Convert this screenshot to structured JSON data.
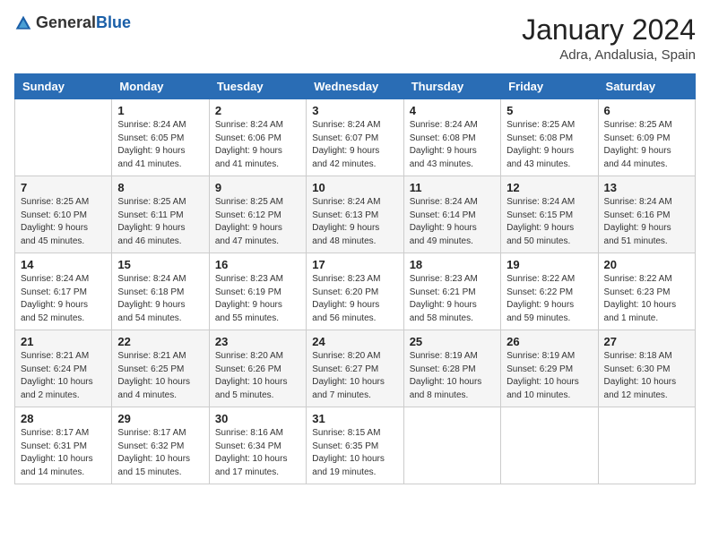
{
  "logo": {
    "text_general": "General",
    "text_blue": "Blue"
  },
  "header": {
    "month": "January 2024",
    "location": "Adra, Andalusia, Spain"
  },
  "weekdays": [
    "Sunday",
    "Monday",
    "Tuesday",
    "Wednesday",
    "Thursday",
    "Friday",
    "Saturday"
  ],
  "weeks": [
    {
      "bg": "white",
      "days": [
        {
          "num": "",
          "info": ""
        },
        {
          "num": "1",
          "info": "Sunrise: 8:24 AM\nSunset: 6:05 PM\nDaylight: 9 hours\nand 41 minutes."
        },
        {
          "num": "2",
          "info": "Sunrise: 8:24 AM\nSunset: 6:06 PM\nDaylight: 9 hours\nand 41 minutes."
        },
        {
          "num": "3",
          "info": "Sunrise: 8:24 AM\nSunset: 6:07 PM\nDaylight: 9 hours\nand 42 minutes."
        },
        {
          "num": "4",
          "info": "Sunrise: 8:24 AM\nSunset: 6:08 PM\nDaylight: 9 hours\nand 43 minutes."
        },
        {
          "num": "5",
          "info": "Sunrise: 8:25 AM\nSunset: 6:08 PM\nDaylight: 9 hours\nand 43 minutes."
        },
        {
          "num": "6",
          "info": "Sunrise: 8:25 AM\nSunset: 6:09 PM\nDaylight: 9 hours\nand 44 minutes."
        }
      ]
    },
    {
      "bg": "gray",
      "days": [
        {
          "num": "7",
          "info": "Sunrise: 8:25 AM\nSunset: 6:10 PM\nDaylight: 9 hours\nand 45 minutes."
        },
        {
          "num": "8",
          "info": "Sunrise: 8:25 AM\nSunset: 6:11 PM\nDaylight: 9 hours\nand 46 minutes."
        },
        {
          "num": "9",
          "info": "Sunrise: 8:25 AM\nSunset: 6:12 PM\nDaylight: 9 hours\nand 47 minutes."
        },
        {
          "num": "10",
          "info": "Sunrise: 8:24 AM\nSunset: 6:13 PM\nDaylight: 9 hours\nand 48 minutes."
        },
        {
          "num": "11",
          "info": "Sunrise: 8:24 AM\nSunset: 6:14 PM\nDaylight: 9 hours\nand 49 minutes."
        },
        {
          "num": "12",
          "info": "Sunrise: 8:24 AM\nSunset: 6:15 PM\nDaylight: 9 hours\nand 50 minutes."
        },
        {
          "num": "13",
          "info": "Sunrise: 8:24 AM\nSunset: 6:16 PM\nDaylight: 9 hours\nand 51 minutes."
        }
      ]
    },
    {
      "bg": "white",
      "days": [
        {
          "num": "14",
          "info": "Sunrise: 8:24 AM\nSunset: 6:17 PM\nDaylight: 9 hours\nand 52 minutes."
        },
        {
          "num": "15",
          "info": "Sunrise: 8:24 AM\nSunset: 6:18 PM\nDaylight: 9 hours\nand 54 minutes."
        },
        {
          "num": "16",
          "info": "Sunrise: 8:23 AM\nSunset: 6:19 PM\nDaylight: 9 hours\nand 55 minutes."
        },
        {
          "num": "17",
          "info": "Sunrise: 8:23 AM\nSunset: 6:20 PM\nDaylight: 9 hours\nand 56 minutes."
        },
        {
          "num": "18",
          "info": "Sunrise: 8:23 AM\nSunset: 6:21 PM\nDaylight: 9 hours\nand 58 minutes."
        },
        {
          "num": "19",
          "info": "Sunrise: 8:22 AM\nSunset: 6:22 PM\nDaylight: 9 hours\nand 59 minutes."
        },
        {
          "num": "20",
          "info": "Sunrise: 8:22 AM\nSunset: 6:23 PM\nDaylight: 10 hours\nand 1 minute."
        }
      ]
    },
    {
      "bg": "gray",
      "days": [
        {
          "num": "21",
          "info": "Sunrise: 8:21 AM\nSunset: 6:24 PM\nDaylight: 10 hours\nand 2 minutes."
        },
        {
          "num": "22",
          "info": "Sunrise: 8:21 AM\nSunset: 6:25 PM\nDaylight: 10 hours\nand 4 minutes."
        },
        {
          "num": "23",
          "info": "Sunrise: 8:20 AM\nSunset: 6:26 PM\nDaylight: 10 hours\nand 5 minutes."
        },
        {
          "num": "24",
          "info": "Sunrise: 8:20 AM\nSunset: 6:27 PM\nDaylight: 10 hours\nand 7 minutes."
        },
        {
          "num": "25",
          "info": "Sunrise: 8:19 AM\nSunset: 6:28 PM\nDaylight: 10 hours\nand 8 minutes."
        },
        {
          "num": "26",
          "info": "Sunrise: 8:19 AM\nSunset: 6:29 PM\nDaylight: 10 hours\nand 10 minutes."
        },
        {
          "num": "27",
          "info": "Sunrise: 8:18 AM\nSunset: 6:30 PM\nDaylight: 10 hours\nand 12 minutes."
        }
      ]
    },
    {
      "bg": "white",
      "days": [
        {
          "num": "28",
          "info": "Sunrise: 8:17 AM\nSunset: 6:31 PM\nDaylight: 10 hours\nand 14 minutes."
        },
        {
          "num": "29",
          "info": "Sunrise: 8:17 AM\nSunset: 6:32 PM\nDaylight: 10 hours\nand 15 minutes."
        },
        {
          "num": "30",
          "info": "Sunrise: 8:16 AM\nSunset: 6:34 PM\nDaylight: 10 hours\nand 17 minutes."
        },
        {
          "num": "31",
          "info": "Sunrise: 8:15 AM\nSunset: 6:35 PM\nDaylight: 10 hours\nand 19 minutes."
        },
        {
          "num": "",
          "info": ""
        },
        {
          "num": "",
          "info": ""
        },
        {
          "num": "",
          "info": ""
        }
      ]
    }
  ]
}
